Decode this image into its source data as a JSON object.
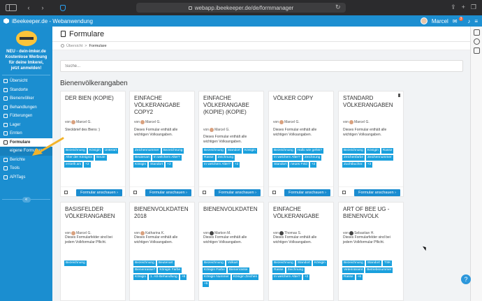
{
  "browser": {
    "url": "webapp.ibeekeeper.de/de/formmanager"
  },
  "app": {
    "title": "iBeekeeper.de - Webanwendung",
    "user": "Marcel",
    "notifications": "3"
  },
  "sidebar": {
    "promo": "NEU - dein-imker.de Kostenlose Werbung für deine Imkerei, jetzt anmelden!",
    "items": [
      {
        "label": "Übersicht"
      },
      {
        "label": "Standorte"
      },
      {
        "label": "Bienenvölker"
      },
      {
        "label": "Behandlungen"
      },
      {
        "label": "Fütterungen"
      },
      {
        "label": "Lager"
      },
      {
        "label": "Ernten"
      },
      {
        "label": "Formulare"
      },
      {
        "label": "eigene Formulare"
      },
      {
        "label": "Berichte"
      },
      {
        "label": "Tools"
      },
      {
        "label": "APITags"
      }
    ],
    "collapse": "«"
  },
  "page": {
    "title": "Formulare",
    "breadcrumb_home": "Übersicht",
    "breadcrumb_sep": ">",
    "breadcrumb_current": "Formulare",
    "search_placeholder": "Suche...",
    "section": "Bienenvölkerangaben"
  },
  "cards": [
    {
      "title": "DER BIEN (KOPIE)",
      "by": "von",
      "author": "Marcel G.",
      "desc": "Steckbrief des Biens :)",
      "tags": [
        "Bezeichnung",
        "Königin",
        "Unterart",
        "Alter der Könignin",
        "Beute",
        "erstellt am",
        "+2"
      ],
      "button": "Formular anschauen ›"
    },
    {
      "title": "EINFACHE VÖLKERANGABE COPY2",
      "by": "von",
      "author": "Marcel G.",
      "desc": "Dieses Formular enthält alle wichtigen Volksangaben.",
      "tags": [
        "Zeichennummer",
        "Bezeichnung",
        "Beutenart",
        "In welchem Alter?",
        "Königin",
        "Standort",
        "+2"
      ],
      "button": "Formular anschauen ›"
    },
    {
      "title": "EINFACHE VÖLKERANGABE (KOPIE) (KOPIE)",
      "by": "von",
      "author": "Marcel G.",
      "desc": "Dieses Formular enthält alle wichtigen Volksangaben.",
      "tags": [
        "Bezeichnung",
        "Standort",
        "Königin",
        "Rasse",
        "Zeichnung",
        "In welchem Alter?",
        "+2"
      ],
      "button": "Formular anschauen ›"
    },
    {
      "title": "VÖLKER COPY",
      "by": "von",
      "author": "Marcel G.",
      "desc": "Dieses Formular enthält alle wichtigen Volksangaben.",
      "tags": [
        "Bezeichnung",
        "Hallo wie gehts?",
        "In welchem Alter?",
        "Zeichnung",
        "Standort",
        "neues Feld",
        "+2"
      ],
      "button": "Formular anschauen ›"
    },
    {
      "title": "STANDARD VÖLKERANGABEN",
      "by": "von",
      "author": "Marcel G.",
      "desc": "Dieses Formular enthält alle wichtigen Volksangaben.",
      "tags": [
        "Bezeichnung",
        "Königin",
        "Rasse",
        "Zeichenfarbe",
        "Zeichennummer",
        "Zuchtbuchnr.",
        "+3"
      ],
      "button": "Formular anschauen ›"
    },
    {
      "title": "BASISFELDER VÖLKERANGABEN",
      "by": "von",
      "author": "Marcel G.",
      "desc": "Dieses Formularfelder sind bei jedem Volkformular Pflicht.",
      "tags": [
        "Bezeichnung"
      ],
      "button": "Formular anschauen ›"
    },
    {
      "title": "BIENENVOLKDATEN 2018",
      "by": "von",
      "author": "Katharina K.",
      "desc": "Dieses Formular enthält alle wichtigen Volksangaben.",
      "tags": [
        "Bezeichnung",
        "Beutenart",
        "Bienenrasse?",
        "Königin Farbe",
        "Königin",
        "1. AS-Behandlung",
        "+8"
      ],
      "button": "Formular anschauen ›"
    },
    {
      "title": "BIENENVOLKDATEN",
      "by": "von",
      "author": "Markon M.",
      "desc": "Dieses Formular enthält alle wichtigen Volksangaben.",
      "tags": [
        "Bezeichnung",
        "Volkart",
        "Königin Farbe",
        "Bienenrasse",
        "Königin Nummer",
        "Königin Zeichen",
        "+5"
      ],
      "button": "Formular anschauen ›"
    },
    {
      "title": "EINFACHE VÖLKERANGABE",
      "by": "von",
      "author": "Thomas S.",
      "desc": "Dieses Formular enthält alle wichtigen Volksangaben.",
      "tags": [
        "Bezeichnung",
        "Standort",
        "Königin",
        "Rasse",
        "Zeichnung",
        "In welchem Alter?",
        "+2"
      ],
      "button": "Formular anschauen ›"
    },
    {
      "title": "ART OF BEE UG - BIENENVOLK",
      "by": "von",
      "author": "Sebastian H.",
      "desc": "Dieses Formularfelder sind bei jedem Volkformular Pflicht.",
      "tags": [
        "Bezeichnung",
        "Standort",
        "TSK",
        "Veterinäramt",
        "Betriebsnummer",
        "Rasse",
        "+6"
      ],
      "button": "Formular anschauen ›"
    }
  ],
  "help": "?",
  "colors": {
    "brand": "#1b8ed0",
    "tag": "#1aa0dd",
    "arrow": "#f3b32a"
  }
}
